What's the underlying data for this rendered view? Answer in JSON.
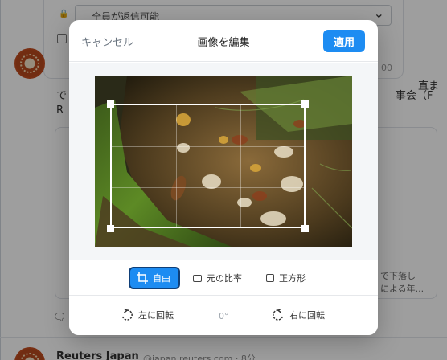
{
  "background": {
    "reply_setting": "全員が返信可能",
    "post_snippet_1": "直ま",
    "post_snippet_2": "で",
    "post_snippet_3": "事会（F",
    "post_snippet_4": "R",
    "time_snippet": "00",
    "card_text_1": "で下落し",
    "card_text_2": "による年...",
    "next_post_name": "Reuters Japan",
    "next_post_handle": "@japan.reuters.com · 8分"
  },
  "modal": {
    "title": "画像を編集",
    "cancel_label": "キャンセル",
    "apply_label": "適用"
  },
  "aspect_options": [
    {
      "label": "自由",
      "icon": "crop-icon",
      "active": true
    },
    {
      "label": "元の比率",
      "icon": "rectangle-icon",
      "active": false
    },
    {
      "label": "正方形",
      "icon": "square-icon",
      "active": false
    }
  ],
  "rotation": {
    "left_label": "左に回転",
    "right_label": "右に回転",
    "degrees": "0°"
  },
  "colors": {
    "accent": "#1d8cf2",
    "active_border": "#0f3f78"
  }
}
